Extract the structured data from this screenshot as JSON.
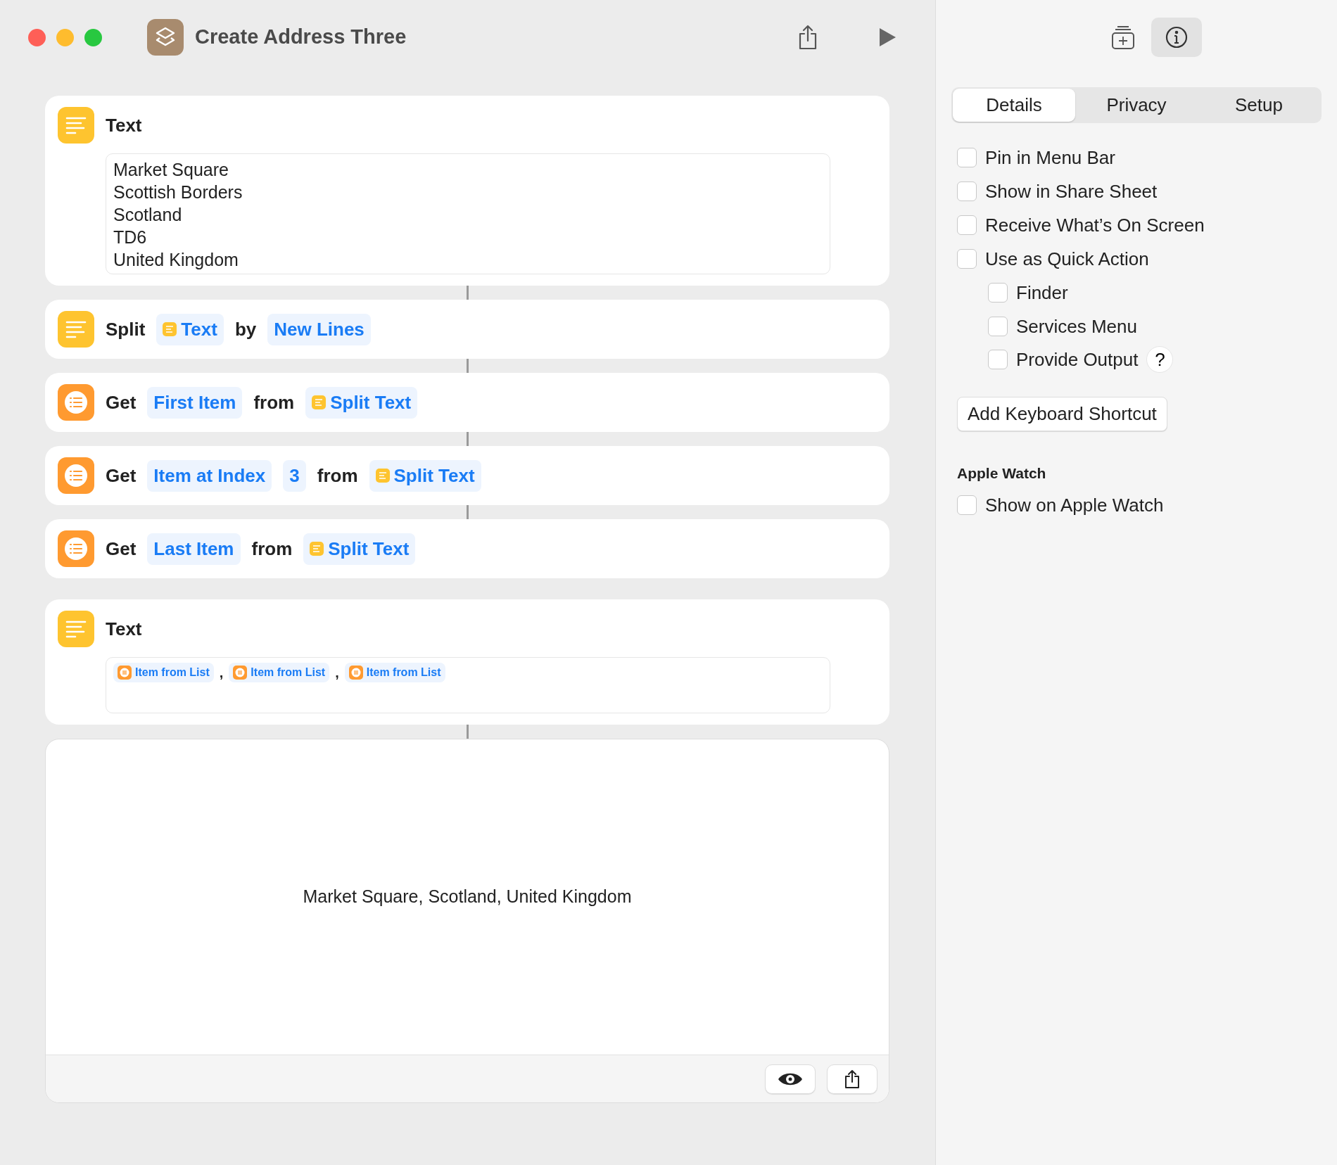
{
  "window": {
    "title": "Create Address Three"
  },
  "actions": [
    {
      "kind": "text",
      "title": "Text",
      "lines": [
        "Market Square",
        "Scottish Borders",
        "Scotland",
        "TD6",
        "United Kingdom"
      ]
    },
    {
      "kind": "split",
      "parts": [
        {
          "kind": "word",
          "text": "Split"
        },
        {
          "kind": "text_var",
          "text": "Text"
        },
        {
          "kind": "word",
          "text": "by"
        },
        {
          "kind": "token",
          "text": "New Lines"
        }
      ]
    },
    {
      "kind": "get",
      "parts": [
        {
          "kind": "word",
          "text": "Get"
        },
        {
          "kind": "token",
          "text": "First Item"
        },
        {
          "kind": "word",
          "text": "from"
        },
        {
          "kind": "text_var",
          "text": "Split Text"
        }
      ]
    },
    {
      "kind": "get",
      "parts": [
        {
          "kind": "word",
          "text": "Get"
        },
        {
          "kind": "token",
          "text": "Item at Index"
        },
        {
          "kind": "token",
          "text": "3"
        },
        {
          "kind": "word",
          "text": "from"
        },
        {
          "kind": "text_var",
          "text": "Split Text"
        }
      ]
    },
    {
      "kind": "get",
      "parts": [
        {
          "kind": "word",
          "text": "Get"
        },
        {
          "kind": "token",
          "text": "Last Item"
        },
        {
          "kind": "word",
          "text": "from"
        },
        {
          "kind": "text_var",
          "text": "Split Text"
        }
      ]
    },
    {
      "kind": "text",
      "title": "Text",
      "tokens": [
        {
          "kind": "list_var",
          "text": "Item from List"
        },
        {
          "kind": "sep",
          "text": ","
        },
        {
          "kind": "list_var",
          "text": "Item from List"
        },
        {
          "kind": "sep",
          "text": ","
        },
        {
          "kind": "list_var",
          "text": "Item from List"
        }
      ]
    }
  ],
  "result": {
    "text": "Market Square, Scotland, United Kingdom"
  },
  "inspector": {
    "tabs": [
      {
        "label": "Details",
        "selected": true
      },
      {
        "label": "Privacy",
        "selected": false
      },
      {
        "label": "Setup",
        "selected": false
      }
    ],
    "options": [
      {
        "label": "Pin in Menu Bar",
        "checked": false
      },
      {
        "label": "Show in Share Sheet",
        "checked": false
      },
      {
        "label": "Receive What’s On Screen",
        "checked": false
      },
      {
        "label": "Use as Quick Action",
        "checked": false,
        "children": [
          {
            "label": "Finder",
            "checked": false
          },
          {
            "label": "Services Menu",
            "checked": false
          },
          {
            "label": "Provide Output",
            "checked": false,
            "help": "?"
          }
        ]
      }
    ],
    "shortcut_button": "Add Keyboard Shortcut",
    "section": "Apple Watch",
    "watch_options": [
      {
        "label": "Show on Apple Watch",
        "checked": false
      }
    ]
  }
}
